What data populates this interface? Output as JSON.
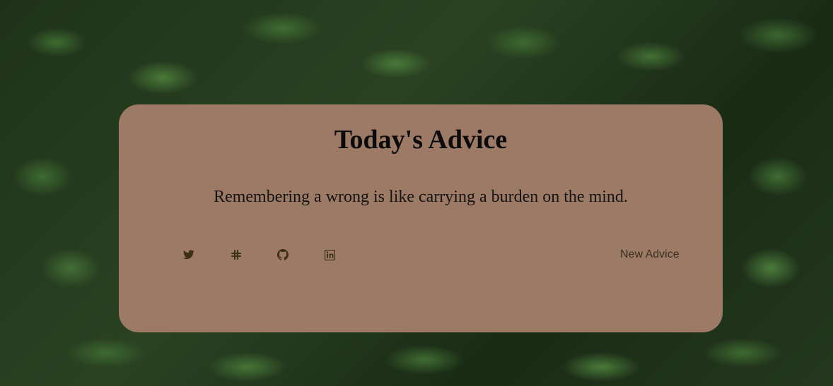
{
  "card": {
    "title": "Today's Advice",
    "advice_text": "Remembering a wrong is like carrying a burden on the mind.",
    "background_color": "#9c7a65"
  },
  "social_links": [
    {
      "icon": "twitter-icon"
    },
    {
      "icon": "slack-icon"
    },
    {
      "icon": "github-icon"
    },
    {
      "icon": "linkedin-icon"
    }
  ],
  "actions": {
    "new_advice_label": "New Advice"
  },
  "colors": {
    "icon_color": "#3b2f16",
    "text_color": "#0b0b0b"
  }
}
